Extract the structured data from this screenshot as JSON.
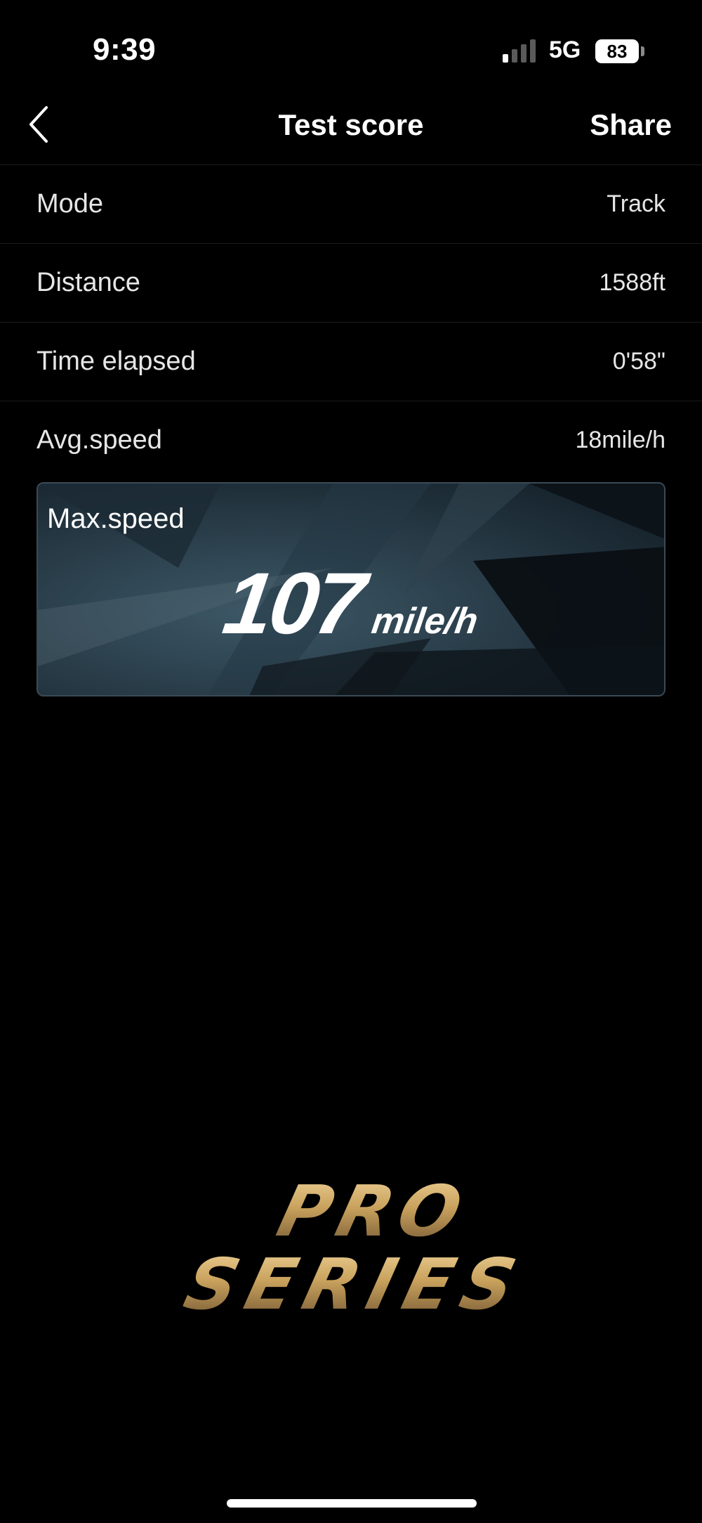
{
  "status_bar": {
    "time": "9:39",
    "network": "5G",
    "battery": "83",
    "signal_bars_active": 1,
    "signal_bars_total": 4
  },
  "nav": {
    "title": "Test score",
    "share_label": "Share",
    "back_icon": "chevron-left-icon"
  },
  "rows": [
    {
      "label": "Mode",
      "value": "Track"
    },
    {
      "label": "Distance",
      "value": "1588ft"
    },
    {
      "label": "Time elapsed",
      "value": "0'58\""
    },
    {
      "label": "Avg.speed",
      "value": "18mile/h"
    }
  ],
  "max_speed": {
    "label": "Max.speed",
    "value": "107",
    "unit": "mile/h"
  },
  "logo": {
    "line1": "PRO",
    "line2": "SERIES"
  },
  "colors": {
    "background": "#000000",
    "card_background": "#16242e",
    "logo_gold": "#c9a25d"
  }
}
